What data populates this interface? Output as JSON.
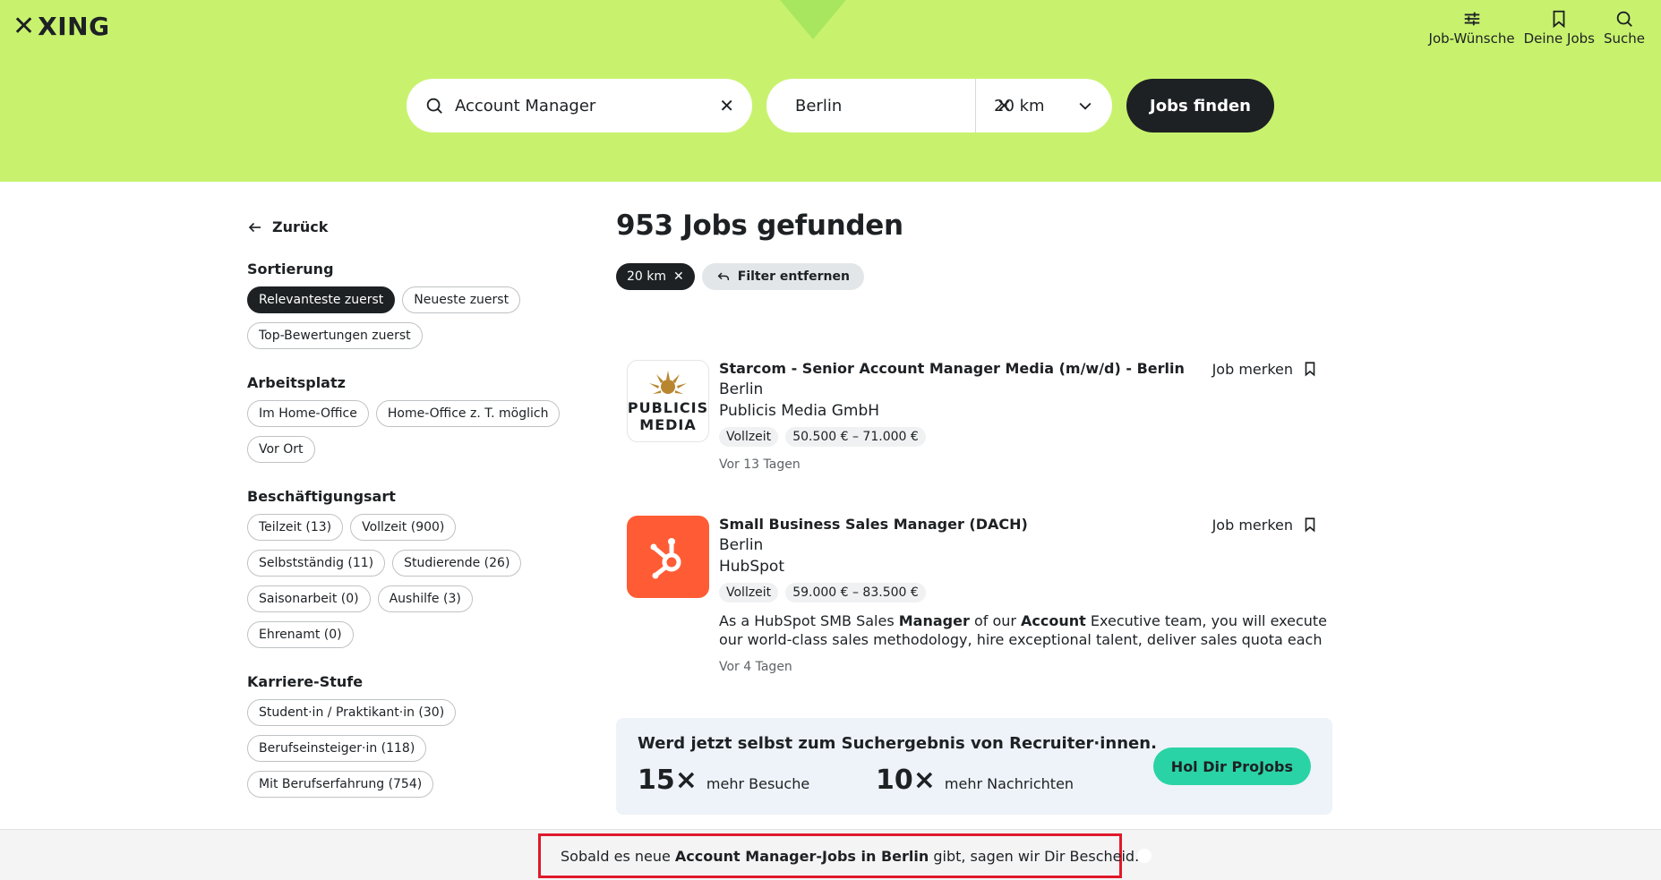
{
  "header": {
    "logo_text": "XING",
    "nav": [
      {
        "label": "Job-Wünsche",
        "icon": "sliders-icon"
      },
      {
        "label": "Deine Jobs",
        "icon": "bookmark-icon"
      },
      {
        "label": "Suche",
        "icon": "search-icon"
      }
    ]
  },
  "search": {
    "keyword": "Account Manager",
    "location": "Berlin",
    "radius": "20 km",
    "submit_label": "Jobs finden"
  },
  "sidebar": {
    "back_label": "Zurück",
    "sections": [
      {
        "title": "Sortierung",
        "chips": [
          "Relevanteste zuerst",
          "Neueste zuerst",
          "Top-Bewertungen zuerst"
        ],
        "active": "Relevanteste zuerst"
      },
      {
        "title": "Arbeitsplatz",
        "chips": [
          "Im Home-Office",
          "Home-Office z. T. möglich",
          "Vor Ort"
        ]
      },
      {
        "title": "Beschäftigungsart",
        "chips": [
          "Teilzeit (13)",
          "Vollzeit (900)",
          "Selbstständig (11)",
          "Studierende (26)",
          "Saisonarbeit (0)",
          "Aushilfe (3)",
          "Ehrenamt (0)"
        ]
      },
      {
        "title": "Karriere-Stufe",
        "chips": [
          "Student·in / Praktikant·in (30)",
          "Berufseinsteiger·in (118)",
          "Mit Berufserfahrung (754)"
        ]
      }
    ]
  },
  "results": {
    "count_label": "953 Jobs gefunden",
    "active_filter": "20 km",
    "remove_filters_label": "Filter entfernen",
    "jobs": [
      {
        "title": "Starcom - Senior Account Manager Media (m/w/d) - Berlin",
        "city": "Berlin",
        "company": "Publicis Media GmbH",
        "tags": [
          "Vollzeit",
          "50.500 € – 71.000 €"
        ],
        "date": "Vor 13 Tagen",
        "save_label": "Job merken",
        "logo_text_1": "PUBLICIS",
        "logo_text_2": "MEDIA"
      },
      {
        "title": "Small Business Sales Manager (DACH)",
        "city": "Berlin",
        "company": "HubSpot",
        "tags": [
          "Vollzeit",
          "59.000 € – 83.500 €"
        ],
        "description": {
          "p1": "As a HubSpot SMB Sales ",
          "b1": "Manager",
          "p2": " of our ",
          "b2": "Account",
          "p3": " Executive team, you will execute our world-class sales methodology, hire exceptional talent, deliver sales quota each"
        },
        "date": "Vor 4 Tagen",
        "save_label": "Job merken"
      }
    ]
  },
  "promo": {
    "title": "Werd jetzt selbst zum Suchergebnis von Recruiter·innen.",
    "stat1_num": "15×",
    "stat1_label": "mehr Besuche",
    "stat2_num": "10×",
    "stat2_label": "mehr Nachrichten",
    "cta": "Hol Dir ProJobs"
  },
  "notification": {
    "pre": "Sobald es neue ",
    "bold": "Account Manager-Jobs in Berlin",
    "post": " gibt, sagen wir Dir Bescheid."
  },
  "colors": {
    "hero": "#c8f26e",
    "dark": "#1d2124",
    "teal": "#2ad3a5",
    "highlight": "#e0192a",
    "hubspot": "#ff5c35"
  }
}
